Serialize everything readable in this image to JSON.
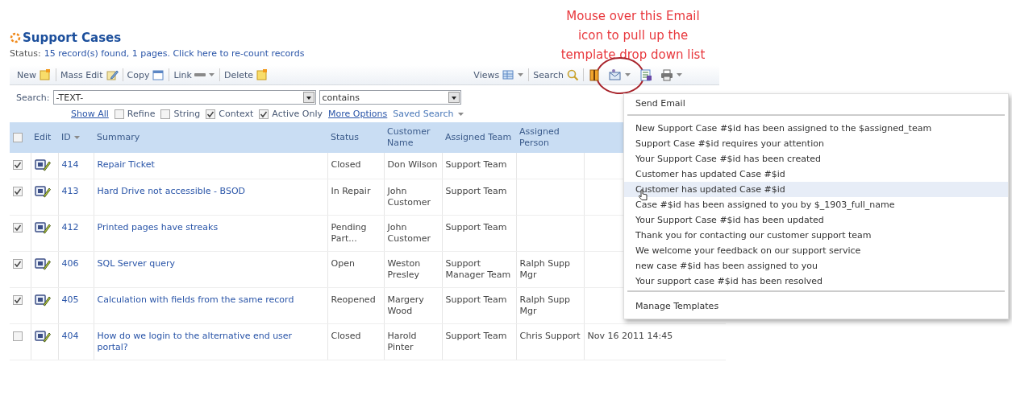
{
  "annotation": {
    "lines": [
      "Mouse over this Email",
      "icon to pull up the",
      "template drop down list"
    ]
  },
  "title": "Support Cases",
  "status": {
    "label": "Status:",
    "link": "15 record(s) found, 1 pages. Click here to re-count records"
  },
  "toolbar": {
    "left": [
      {
        "label": "New",
        "dropdown": false
      },
      {
        "label": "Mass Edit",
        "dropdown": false
      },
      {
        "label": "Copy",
        "dropdown": false
      },
      {
        "label": "Link",
        "dropdown": true
      },
      {
        "label": "Delete",
        "dropdown": false
      }
    ],
    "right": [
      {
        "label": "Views",
        "dropdown": true
      },
      {
        "label": "Search",
        "dropdown": false
      },
      {
        "dropdown": false
      },
      {
        "dropdown": true
      },
      {
        "dropdown": false
      },
      {
        "dropdown": true
      }
    ]
  },
  "search": {
    "label": "Search:",
    "field": "-TEXT-",
    "operator": "contains",
    "options": [
      {
        "kind": "link",
        "label": "Show All"
      },
      {
        "kind": "checkbox",
        "label": "Refine",
        "checked": false
      },
      {
        "kind": "checkbox",
        "label": "String",
        "checked": false
      },
      {
        "kind": "checkbox",
        "label": "Context",
        "checked": true
      },
      {
        "kind": "checkbox",
        "label": "Active Only",
        "checked": true
      },
      {
        "kind": "link",
        "label": "More Options"
      },
      {
        "kind": "menu",
        "label": "Saved Search"
      }
    ]
  },
  "table": {
    "select_all": {
      "checked": false
    },
    "columns": [
      {
        "label": "Edit",
        "sorted": false
      },
      {
        "label": "ID",
        "sorted": true
      },
      {
        "label": "Summary",
        "sorted": false
      },
      {
        "label": "Status",
        "sorted": false
      },
      {
        "label": "Customer Name",
        "sorted": false
      },
      {
        "label": "Assigned Team",
        "sorted": false
      },
      {
        "label": "Assigned Person",
        "sorted": false
      }
    ],
    "rows": [
      {
        "checked": true,
        "id": "414",
        "summary": "Repair Ticket",
        "status": "Closed",
        "customer_name": "Don Wilson",
        "assigned_team": "Support Team"
      },
      {
        "checked": true,
        "id": "413",
        "summary": "Hard Drive not accessible - BSOD",
        "status": "In Repair",
        "customer_name": "John Customer",
        "assigned_team": "Support Team"
      },
      {
        "checked": true,
        "id": "412",
        "summary": "Printed pages have streaks",
        "status": "Pending Part...",
        "customer_name": "John Customer",
        "assigned_team": "Support Team"
      },
      {
        "checked": true,
        "id": "406",
        "summary": "SQL Server query",
        "status": "Open",
        "customer_name": "Weston Presley",
        "assigned_team": "Support Manager Team",
        "assigned_person": "Ralph Supp Mgr"
      },
      {
        "checked": true,
        "id": "405",
        "summary": "Calculation with fields from the same record",
        "status": "Reopened",
        "customer_name": "Margery Wood",
        "assigned_team": "Support Team",
        "assigned_person": "Ralph Supp Mgr"
      },
      {
        "checked": false,
        "id": "404",
        "summary": "How do we login to the alternative end user portal?",
        "status": "Closed",
        "customer_name": "Harold Pinter",
        "assigned_team": "Support Team",
        "assigned_person": "Chris Support",
        "column_9": "Nov 16 2011 14:45"
      }
    ]
  },
  "email_menu": {
    "title": "Send Email",
    "items": [
      {
        "label": "New Support Case #$id has been assigned to the $assigned_team",
        "selected": false
      },
      {
        "label": "Support Case #$id requires your attention",
        "selected": false
      },
      {
        "label": "Your Support Case #$id has been created",
        "selected": false
      },
      {
        "label": "Customer has updated Case #$id",
        "selected": false
      },
      {
        "label": "Customer has updated Case #$id",
        "selected": true
      },
      {
        "label": "Case #$id has been assigned to you by $_1903_full_name",
        "selected": false
      },
      {
        "label": "Your Support Case #$id has been updated",
        "selected": false
      },
      {
        "label": "Thank you for contacting our customer support team",
        "selected": false
      },
      {
        "label": "We welcome your feedback on our support service",
        "selected": false
      },
      {
        "label": "new case #$id has been assigned to you",
        "selected": false
      },
      {
        "label": "Your support case #$id has been resolved",
        "selected": false
      }
    ],
    "footer": "Manage Templates"
  }
}
